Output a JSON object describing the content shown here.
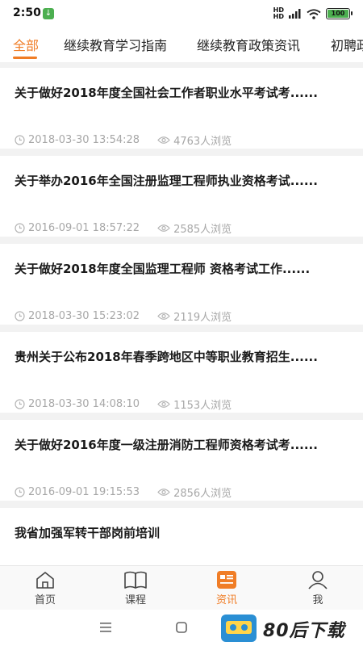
{
  "status": {
    "time": "2:50",
    "battery": "100"
  },
  "tabs": [
    {
      "label": "全部",
      "active": true
    },
    {
      "label": "继续教育学习指南"
    },
    {
      "label": "继续教育政策资讯"
    },
    {
      "label": "初聘政"
    }
  ],
  "articles": [
    {
      "title": "关于做好2018年度全国社会工作者职业水平考试考......",
      "datetime": "2018-03-30 13:54:28",
      "views": "4763人浏览"
    },
    {
      "title": "关于举办2016年全国注册监理工程师执业资格考试......",
      "datetime": "2016-09-01 18:57:22",
      "views": "2585人浏览"
    },
    {
      "title": "关于做好2018年度全国监理工程师 资格考试工作......",
      "datetime": "2018-03-30 15:23:02",
      "views": "2119人浏览"
    },
    {
      "title": "贵州关于公布2018年春季跨地区中等职业教育招生......",
      "datetime": "2018-03-30 14:08:10",
      "views": "1153人浏览"
    },
    {
      "title": "关于做好2016年度一级注册消防工程师资格考试考......",
      "datetime": "2016-09-01 19:15:53",
      "views": "2856人浏览"
    },
    {
      "title": "我省加强军转干部岗前培训"
    }
  ],
  "bottom_nav": [
    {
      "label": "首页",
      "icon": "home-icon"
    },
    {
      "label": "课程",
      "icon": "book-icon"
    },
    {
      "label": "资讯",
      "icon": "news-icon",
      "active": true
    },
    {
      "label": "我",
      "icon": "profile-icon"
    }
  ],
  "watermark": {
    "text": "80后下载"
  },
  "colors": {
    "accent": "#f07d26",
    "meta": "#a7a7a7",
    "separator": "#f2f2f2"
  }
}
